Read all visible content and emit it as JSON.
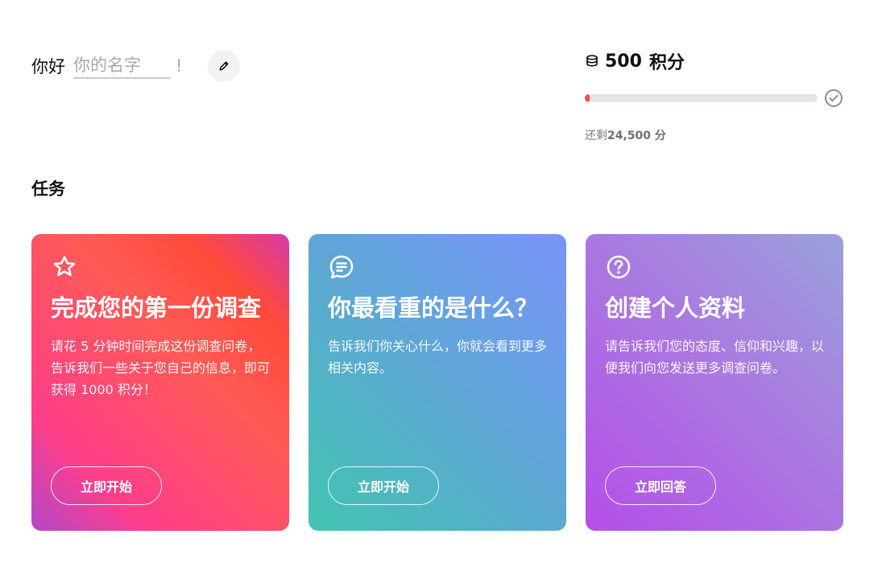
{
  "greeting": {
    "hello": "你好",
    "name_placeholder": "你的名字",
    "exclamation": "!"
  },
  "points": {
    "total": "500",
    "unit": "积分",
    "progress_fraction": 0.02,
    "remaining_prefix": "还剩",
    "remaining_amount": "24,500 分"
  },
  "tasks": {
    "title": "任务",
    "cards": [
      {
        "icon": "star-icon",
        "title": "完成您的第一份调查",
        "description": "请花 5 分钟时间完成这份调查问卷，告诉我们一些关于您自己的信息，即可获得 1000 积分！",
        "button": "立即开始"
      },
      {
        "icon": "chat-bubble-icon",
        "title": "你最看重的是什么？",
        "description": "告诉我们你关心什么，你就会看到更多相关内容。",
        "button": "立即开始"
      },
      {
        "icon": "question-circle-icon",
        "title": "创建个人资料",
        "description": "请告诉我们您的态度、信仰和兴趣，以便我们向您发送更多调查问卷。",
        "button": "立即回答"
      }
    ]
  },
  "colors": {
    "progress_fill": "#ef4c5a",
    "progress_track": "#e3e5e9"
  }
}
